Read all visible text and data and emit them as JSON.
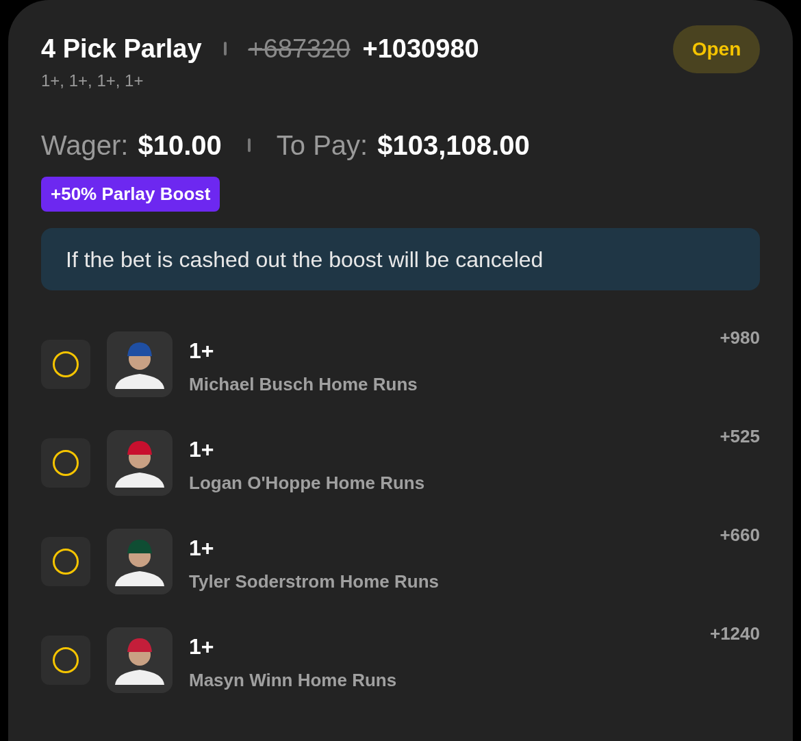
{
  "bet": {
    "title": "4 Pick Parlay",
    "original_odds": "+687320",
    "boosted_odds": "+1030980",
    "status": "Open",
    "summary": "1+, 1+, 1+, 1+"
  },
  "payout": {
    "wager_label": "Wager:",
    "wager": "$10.00",
    "to_pay_label": "To Pay:",
    "to_pay": "$103,108.00"
  },
  "boost_badge": "+50% Parlay Boost",
  "notice": "If the bet is cashed out the boost will be canceled",
  "legs": [
    {
      "line": "1+",
      "market": "Michael Busch Home Runs",
      "odds": "+980",
      "color": "#1f4fa3"
    },
    {
      "line": "1+",
      "market": "Logan O'Hoppe Home Runs",
      "odds": "+525",
      "color": "#c8102e"
    },
    {
      "line": "1+",
      "market": "Tyler Soderstrom Home Runs",
      "odds": "+660",
      "color": "#0f4d33"
    },
    {
      "line": "1+",
      "market": "Masyn Winn Home Runs",
      "odds": "+1240",
      "color": "#c41e3a"
    }
  ]
}
